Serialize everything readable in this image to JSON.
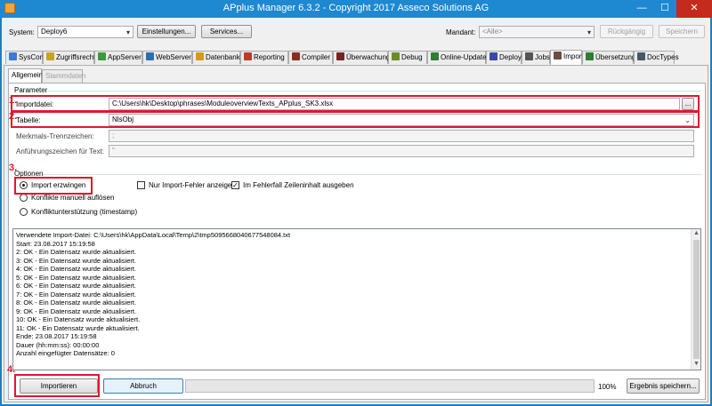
{
  "window": {
    "title": "APplus Manager 6.3.2 - Copyright 2017 Asseco Solutions AG",
    "minimize": "—",
    "maximize": "☐",
    "close": "✕"
  },
  "toolbar": {
    "system_label": "System:",
    "system_value": "Deploy6",
    "settings_button": "Einstellungen...",
    "services_button": "Services...",
    "mandant_label": "Mandant:",
    "mandant_value": "<Alle>",
    "undo_button": "Rückgängig",
    "save_button": "Speichern"
  },
  "tabs": [
    {
      "label": "SysConf",
      "icon": "syscfg-icon",
      "color": "#3a7bd5"
    },
    {
      "label": "Zugriffsrechte",
      "icon": "key-icon",
      "color": "#c9a227"
    },
    {
      "label": "AppServer",
      "icon": "server-icon",
      "color": "#3b9a3b"
    },
    {
      "label": "WebServer",
      "icon": "globe-icon",
      "color": "#2b6fb3"
    },
    {
      "label": "Datenbank",
      "icon": "database-icon",
      "color": "#d79a18"
    },
    {
      "label": "Reporting",
      "icon": "chart-icon",
      "color": "#c0392b"
    },
    {
      "label": "Compiler",
      "icon": "compiler-icon",
      "color": "#8e2d1d"
    },
    {
      "label": "Überwachung",
      "icon": "monitor-icon",
      "color": "#7a2323"
    },
    {
      "label": "Debug",
      "icon": "bug-icon",
      "color": "#6b8e23"
    },
    {
      "label": "Online-Update",
      "icon": "update-icon",
      "color": "#2e7d32"
    },
    {
      "label": "Deploy",
      "icon": "deploy-icon",
      "color": "#3949ab"
    },
    {
      "label": "Jobs",
      "icon": "jobs-icon",
      "color": "#555555"
    },
    {
      "label": "Import",
      "icon": "import-icon",
      "color": "#6d4c41"
    },
    {
      "label": "Übersetzung",
      "icon": "translate-icon",
      "color": "#2e7d32"
    },
    {
      "label": "DocTypes",
      "icon": "doctypes-icon",
      "color": "#455a64"
    }
  ],
  "subtabs": [
    "Allgemein",
    "Stammdaten"
  ],
  "parameter": {
    "group_title": "Parameter",
    "importfile_label": "Importdatei:",
    "importfile_value": "C:\\Users\\hk\\Desktop\\phrases\\ModuleoverviewTexts_APplus_SK3.xlsx",
    "browse_label": "...",
    "table_label": "Tabelle:",
    "table_value": "NlsObj",
    "separator_label": "Merkmals-Trennzeichen:",
    "separator_value": ";",
    "quote_label": "Anführungszeichen für Text:",
    "quote_value": "\""
  },
  "options": {
    "group_title": "Optionen",
    "radio_force": "Import erzwingen",
    "radio_conflicts": "Konflikte manuell auflösen",
    "radio_support": "Konfliktunterstützung (timestamp)",
    "check_errors_only": "Nur Import-Fehler anzeigen",
    "check_row_content": "Im Fehlerfall Zeileninhalt ausgeben",
    "check_mark": "✓"
  },
  "log": [
    "Verwendete Import-Datei: C:\\Users\\hk\\AppData\\Local\\Temp\\2\\tmp5095668040677548084.txt",
    "Start: 23.08.2017 15:19:58",
    "2: OK - Ein Datensatz wurde aktualisiert.",
    "3: OK - Ein Datensatz wurde aktualisiert.",
    "4: OK - Ein Datensatz wurde aktualisiert.",
    "5: OK - Ein Datensatz wurde aktualisiert.",
    "6: OK - Ein Datensatz wurde aktualisiert.",
    "7: OK - Ein Datensatz wurde aktualisiert.",
    "8: OK - Ein Datensatz wurde aktualisiert.",
    "9: OK - Ein Datensatz wurde aktualisiert.",
    "10: OK - Ein Datensatz wurde aktualisiert.",
    "11: OK - Ein Datensatz wurde aktualisiert.",
    "Ende: 23.08.2017 15:19:58",
    "Dauer (hh:mm:ss): 00:00:00",
    "Anzahl eingefügter Datensätze: 0"
  ],
  "bottom": {
    "import_button": "Importieren",
    "abort_button": "Abbruch",
    "progress_label": "100%",
    "progress_value": 1.0,
    "save_result_button": "Ergebnis speichern..."
  },
  "annotations": [
    "1.",
    "2.",
    "3.",
    "4."
  ],
  "highlight_color": "#e0182a"
}
